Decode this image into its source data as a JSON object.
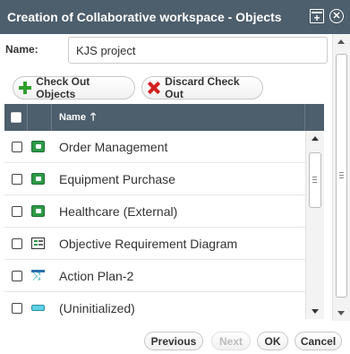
{
  "window": {
    "title": "Creation of Collaborative workspace - Objects"
  },
  "form": {
    "name_label": "Name:",
    "name_value": "KJS project"
  },
  "toolbar": {
    "checkout_label": "Check Out Objects",
    "discard_label": "Discard Check Out"
  },
  "grid": {
    "columns": [
      "Name"
    ],
    "sort": "ascending",
    "rows": [
      {
        "label": "Order Management",
        "icon": "object-icon",
        "checked": false
      },
      {
        "label": "Equipment Purchase",
        "icon": "object-icon",
        "checked": false
      },
      {
        "label": "Healthcare (External)",
        "icon": "object-icon",
        "checked": false
      },
      {
        "label": "Objective Requirement Diagram",
        "icon": "requirement-diagram-icon",
        "checked": false
      },
      {
        "label": "Action Plan-2",
        "icon": "action-plan-icon",
        "checked": false
      },
      {
        "label": "(Uninitialized)",
        "icon": "uninitialized-icon",
        "checked": false
      }
    ]
  },
  "footer": {
    "previous_label": "Previous",
    "next_label": "Next",
    "ok_label": "OK",
    "cancel_label": "Cancel"
  }
}
